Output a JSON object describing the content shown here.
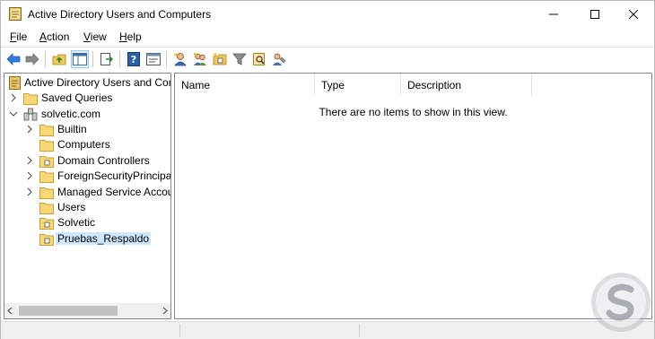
{
  "window": {
    "title": "Active Directory Users and Computers",
    "controls": [
      "minimize",
      "maximize",
      "close"
    ]
  },
  "menu": [
    {
      "label": "File",
      "mnemonic": "F",
      "rest": "ile"
    },
    {
      "label": "Action",
      "mnemonic": "A",
      "rest": "ction"
    },
    {
      "label": "View",
      "mnemonic": "V",
      "rest": "iew"
    },
    {
      "label": "Help",
      "mnemonic": "H",
      "rest": "elp"
    }
  ],
  "toolbar": {
    "icons": [
      "back-arrow-icon",
      "forward-arrow-icon",
      "up-folder-icon",
      "show-hide-console-tree-icon",
      "export-list-icon",
      "help-icon",
      "properties-icon",
      "new-user-icon",
      "new-group-icon",
      "new-ou-icon",
      "filter-icon",
      "find-icon",
      "delegate-control-icon"
    ]
  },
  "tree": {
    "root": "Active Directory Users and Com",
    "items": [
      {
        "label": "Saved Queries",
        "icon": "folder-icon",
        "expander": "right"
      },
      {
        "label": "solvetic.com",
        "icon": "domain-icon",
        "expander": "down"
      },
      {
        "label": "Builtin",
        "icon": "folder-icon",
        "expander": "right"
      },
      {
        "label": "Computers",
        "icon": "folder-icon",
        "expander": "none"
      },
      {
        "label": "Domain Controllers",
        "icon": "ou-folder-icon",
        "expander": "right"
      },
      {
        "label": "ForeignSecurityPrincipals",
        "icon": "folder-icon",
        "expander": "right"
      },
      {
        "label": "Managed Service Accour",
        "icon": "folder-icon",
        "expander": "right"
      },
      {
        "label": "Users",
        "icon": "folder-icon",
        "expander": "none"
      },
      {
        "label": "Solvetic",
        "icon": "ou-folder-icon",
        "expander": "none"
      },
      {
        "label": "Pruebas_Respaldo",
        "icon": "ou-folder-icon",
        "expander": "none",
        "selected": true
      }
    ]
  },
  "list": {
    "columns": [
      "Name",
      "Type",
      "Description"
    ],
    "empty_message": "There are no items to show in this view."
  },
  "colors": {
    "selection": "#cce8ff",
    "folder": "#f8d775",
    "accent": "#1e6fc9"
  }
}
